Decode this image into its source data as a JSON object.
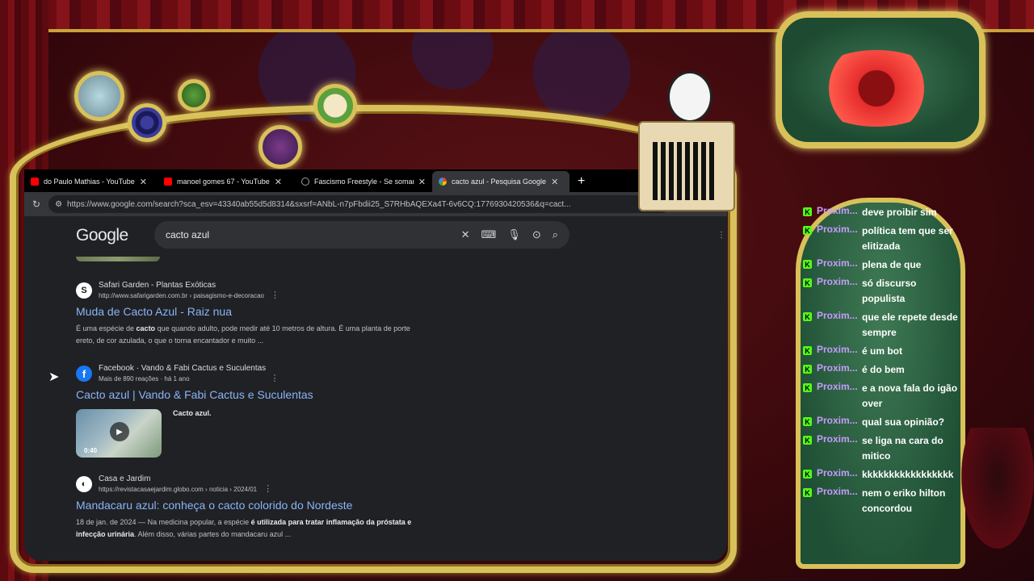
{
  "browser": {
    "tabs": [
      {
        "label": "do Paulo Mathias - YouTube",
        "favicon_color": "#ff0000",
        "active": false
      },
      {
        "label": "manoel gomes 67 - YouTube",
        "favicon_color": "#ff0000",
        "active": false
      },
      {
        "label": "Fascismo Freestyle - Se somar o C",
        "favicon_color": "#9aa0a6",
        "active": false
      },
      {
        "label": "cacto azul - Pesquisa Google",
        "favicon_color": "#4285f4",
        "active": true
      }
    ],
    "new_tab": "+",
    "tab_close": "✕",
    "url": "https://www.google.com/search?sca_esv=43340ab55d5d8314&sxsrf=ANbL-n7pFbdii25_S7RHbAQEXa4T-6v6CQ:1776930420536&q=cact..."
  },
  "google": {
    "logo": "Google",
    "query": "cacto azul"
  },
  "results": [
    {
      "source_name": "Safari Garden - Plantas Exóticas",
      "source_url": "http://www.safarigarden.com.br › paisagismo-e-decoracao",
      "title": "Muda de Cacto Azul - Raiz nua",
      "snippet_line1_a": "É uma espécie de ",
      "snippet_line1_b": "cacto",
      "snippet_line1_c": " que quando adulto, pode medir até 10 metros de altura. É uma planta de porte",
      "snippet_line2": "ereto, de cor azulada, o que o torna encantador e muito ..."
    },
    {
      "source_name": "Facebook · Vando & Fabi Cactus e Suculentas",
      "source_url": "Mais de 890 reações · há 1 ano",
      "title": "Cacto azul | Vando & Fabi Cactus e Suculentas",
      "video_duration": "0:40",
      "video_label": "Cacto azul."
    },
    {
      "source_name": "Casa e Jardim",
      "source_url": "https://revistacasaejardim.globo.com › noticia › 2024/01",
      "title": "Mandacaru azul: conheça o cacto colorido do Nordeste",
      "snippet_line1_a": "18 de jan. de 2024 — Na medicina popular, a espécie ",
      "snippet_line1_b": "é utilizada para tratar inflamação da próstata e",
      "snippet_line2_a": "infecção urinária",
      "snippet_line2_b": ". Além disso, várias partes do mandacaru azul ..."
    }
  ],
  "chat": {
    "badge": "K",
    "messages": [
      {
        "user": "Proxim...",
        "text": "deve proibir sim"
      },
      {
        "user": "Proxim...",
        "text": "política tem que ser elitizada"
      },
      {
        "user": "Proxim...",
        "text": "plena de que"
      },
      {
        "user": "Proxim...",
        "text": "só discurso populista"
      },
      {
        "user": "Proxim...",
        "text": "que ele repete desde sempre"
      },
      {
        "user": "Proxim...",
        "text": "é um bot"
      },
      {
        "user": "Proxim...",
        "text": "é do bem"
      },
      {
        "user": "Proxim...",
        "text": "e a nova fala do igão over"
      },
      {
        "user": "Proxim...",
        "text": "qual sua opinião?"
      },
      {
        "user": "Proxim...",
        "text": "se liga na cara do mitico"
      },
      {
        "user": "Proxim...",
        "text": "kkkkkkkkkkkkkkkkk"
      },
      {
        "user": "Proxim...",
        "text": "nem o eriko hilton concordou"
      }
    ]
  },
  "colors": {
    "gold": "#d9c15a",
    "link": "#8ab4f8",
    "kick_green": "#53fc18",
    "chat_user": "#c79bff"
  }
}
